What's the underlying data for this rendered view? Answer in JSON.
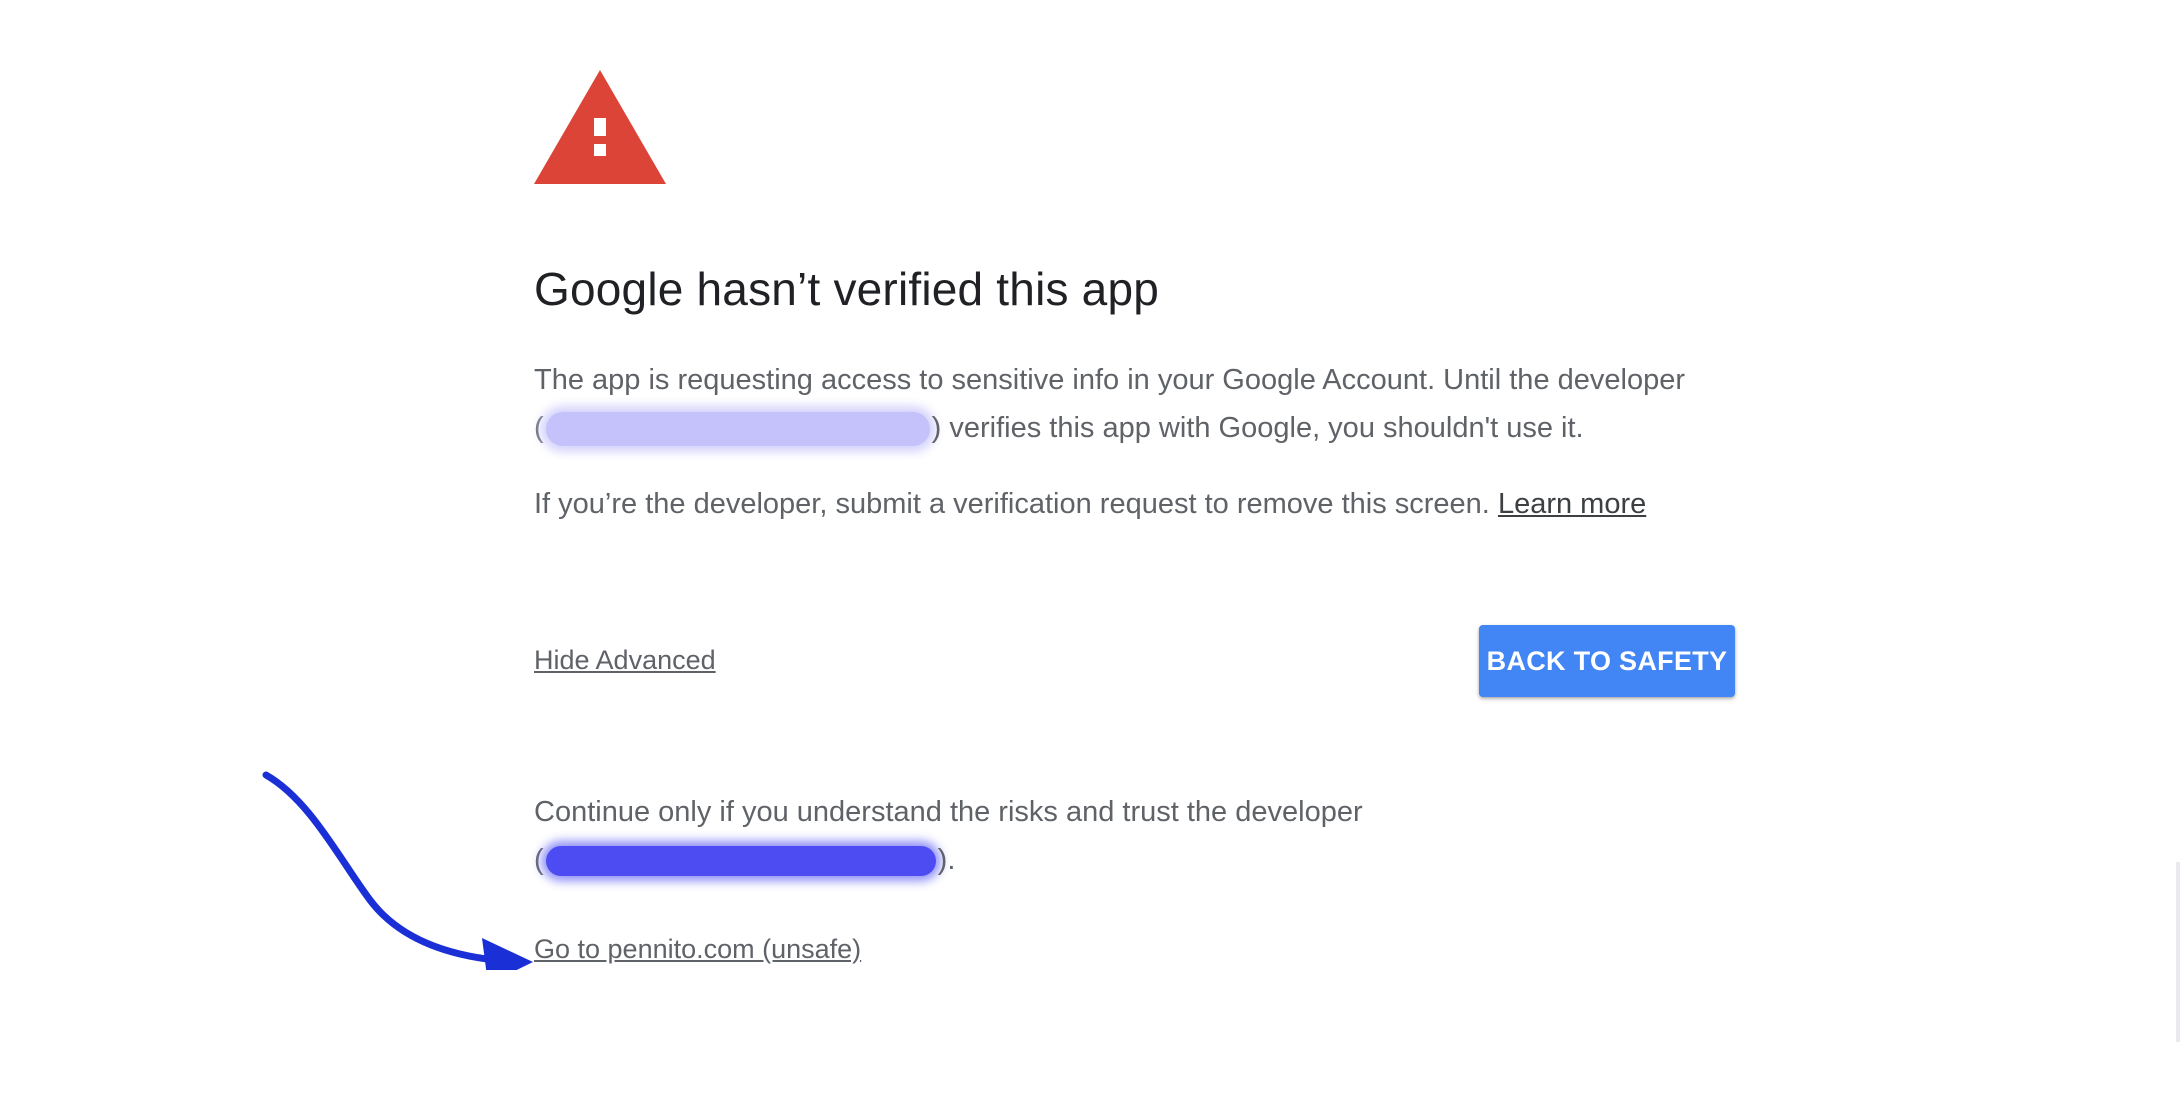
{
  "icon": {
    "name": "warning-icon",
    "color": "#db4437"
  },
  "title": "Google hasn’t verified this app",
  "paragraph1": {
    "text_start": "The app is requesting access to sensitive info in your Google Account. Until the developer",
    "open_paren": "(",
    "text_end": ") verifies this app with Google, you shouldn't use it."
  },
  "paragraph2": {
    "text": "If you’re the developer, submit a verification request to remove this screen.",
    "learn_more": "Learn more"
  },
  "hide_advanced": "Hide Advanced",
  "back_to_safety": "BACK TO SAFETY",
  "paragraph3": {
    "text": "Continue only if you understand the risks and trust the developer",
    "open_paren": "(",
    "close": ")."
  },
  "go_unsafe": "Go to pennito.com (unsafe)",
  "colors": {
    "accent": "#4285f4",
    "warning": "#db4437",
    "annotation_arrow": "#1a2fd6"
  }
}
